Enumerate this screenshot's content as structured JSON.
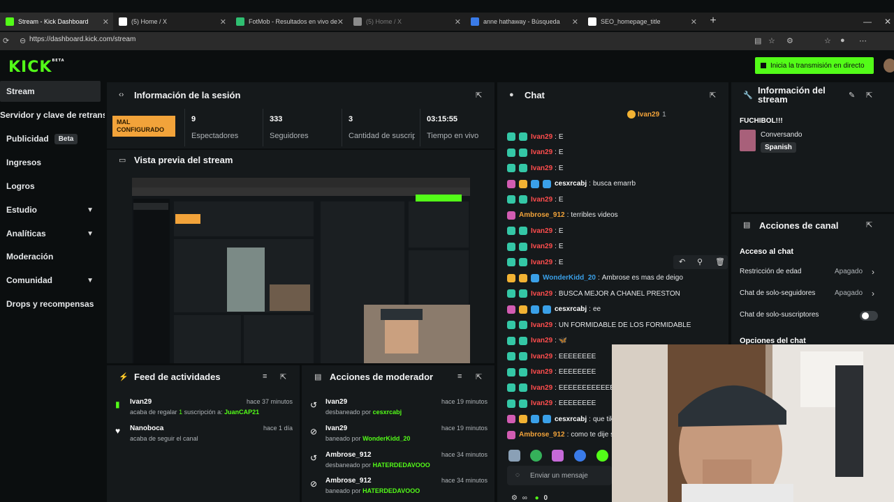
{
  "browser": {
    "tabs": [
      {
        "title": "Stream - Kick Dashboard",
        "favicon_color": "#53fc18"
      },
      {
        "title": "(5) Home / X",
        "favicon_color": "#ffffff"
      },
      {
        "title": "FotMob - Resultados en vivo de fú",
        "favicon_color": "#2fbf71"
      },
      {
        "title": "(5) Home / X",
        "favicon_color": "#8c8c8c"
      },
      {
        "title": "anne hathaway - Búsqueda",
        "favicon_color": "#3a7be8"
      },
      {
        "title": "SEO_homepage_title",
        "favicon_color": "#ffffff"
      }
    ],
    "url": "https://dashboard.kick.com/stream"
  },
  "header": {
    "logo": "KICK",
    "logo_badge": "BETA",
    "go_live": "Inicia la transmisión en directo",
    "accent": "#53fc18"
  },
  "sidebar": {
    "items": [
      {
        "label": "Stream",
        "active": true
      },
      {
        "label": "Servidor y clave de retransm"
      },
      {
        "label": "Publicidad",
        "badge": "Beta"
      },
      {
        "label": "Ingresos"
      },
      {
        "label": "Logros"
      },
      {
        "label": "Estudio",
        "chevron": true
      },
      {
        "label": "Analíticas",
        "chevron": true
      },
      {
        "label": "Moderación"
      },
      {
        "label": "Comunidad",
        "chevron": true
      },
      {
        "label": "Drops y recompensas"
      }
    ]
  },
  "session": {
    "title": "Información de la sesión",
    "status": "MAL CONFIGURADO",
    "stats": [
      {
        "value": "9",
        "label": "Espectadores"
      },
      {
        "value": "333",
        "label": "Seguidores"
      },
      {
        "value": "3",
        "label": "Cantidad de suscripciones"
      },
      {
        "value": "03:15:55",
        "label": "Tiempo en vivo"
      }
    ]
  },
  "preview": {
    "title": "Vista previa del stream"
  },
  "feed": {
    "title": "Feed de actividades",
    "items": [
      {
        "user": "Ivan29",
        "text_before": "acaba de regalar",
        "count": "1",
        "text_mid": "suscripción a:",
        "target": "JuanCAP21",
        "time": "hace 37 minutos"
      },
      {
        "user": "Nanoboca",
        "text": "acaba de seguir el canal",
        "time": "hace 1 día"
      }
    ]
  },
  "moderator": {
    "title": "Acciones de moderador",
    "items": [
      {
        "user": "Ivan29",
        "action": "desbaneado por",
        "by": "cesxrcabj",
        "time": "hace 19 minutos"
      },
      {
        "user": "Ivan29",
        "action": "baneado por",
        "by": "WonderKidd_20",
        "time": "hace 19 minutos"
      },
      {
        "user": "Ambrose_912",
        "action": "desbaneado por",
        "by": "HATERDEDAVOOO",
        "time": "hace 34 minutos"
      },
      {
        "user": "Ambrose_912",
        "action": "baneado por",
        "by": "HATERDEDAVOOO",
        "time": "hace 34 minutos"
      }
    ]
  },
  "chat": {
    "title": "Chat",
    "pinned_user": "Ivan29",
    "pinned_count": "1",
    "messages": [
      {
        "user": "Ivan29",
        "color": "red",
        "badges": [
          "g",
          "g"
        ],
        "text": "E"
      },
      {
        "user": "Ivan29",
        "color": "red",
        "badges": [
          "g",
          "g"
        ],
        "text": "E"
      },
      {
        "user": "Ivan29",
        "color": "red",
        "badges": [
          "g",
          "g"
        ],
        "text": "E"
      },
      {
        "user": "cesxrcabj",
        "color": "white",
        "badges": [
          "p",
          "y",
          "c",
          "c"
        ],
        "text": "busca emarrb"
      },
      {
        "user": "Ivan29",
        "color": "red",
        "badges": [
          "g",
          "g"
        ],
        "text": "E"
      },
      {
        "user": "Ambrose_912",
        "color": "orange",
        "badges": [
          "p"
        ],
        "text": "terribles videos"
      },
      {
        "user": "Ivan29",
        "color": "red",
        "badges": [
          "g",
          "g"
        ],
        "text": "E"
      },
      {
        "user": "Ivan29",
        "color": "red",
        "badges": [
          "g",
          "g"
        ],
        "text": "E"
      },
      {
        "user": "Ivan29",
        "color": "red",
        "badges": [
          "g",
          "g"
        ],
        "text": "E"
      },
      {
        "user": "WonderKidd_20",
        "color": "blue",
        "badges": [
          "y",
          "y",
          "c"
        ],
        "text": "Ambrose es mas de deigo"
      },
      {
        "user": "Ivan29",
        "color": "red",
        "badges": [
          "g",
          "g"
        ],
        "text": "BUSCA MEJOR A CHANEL PRESTON"
      },
      {
        "user": "cesxrcabj",
        "color": "white",
        "badges": [
          "p",
          "y",
          "c",
          "c"
        ],
        "text": "ee"
      },
      {
        "user": "Ivan29",
        "color": "red",
        "badges": [
          "g",
          "g"
        ],
        "text": "UN FORMIDABLE DE LOS FORMIDABLE"
      },
      {
        "user": "Ivan29",
        "color": "red",
        "badges": [
          "g",
          "g"
        ],
        "text": "🦋"
      },
      {
        "user": "Ivan29",
        "color": "red",
        "badges": [
          "g",
          "g"
        ],
        "text": "EEEEEEEE"
      },
      {
        "user": "Ivan29",
        "color": "red",
        "badges": [
          "g",
          "g"
        ],
        "text": "EEEEEEEE"
      },
      {
        "user": "Ivan29",
        "color": "red",
        "badges": [
          "g",
          "g"
        ],
        "text": "EEEEEEEEEEEE"
      },
      {
        "user": "Ivan29",
        "color": "red",
        "badges": [
          "g",
          "g"
        ],
        "text": "EEEEEEEE"
      },
      {
        "user": "cesxrcabj",
        "color": "white",
        "badges": [
          "p",
          "y",
          "c",
          "c"
        ],
        "text": "que tik"
      },
      {
        "user": "Ambrose_912",
        "color": "orange",
        "badges": [
          "p"
        ],
        "text": "como te dije s"
      }
    ],
    "input_placeholder": "Enviar un mensaje",
    "footer_count": "0"
  },
  "stream_info": {
    "title": "Información del stream",
    "stream_title": "FUCHIBOL!!!",
    "category": "Conversando",
    "language": "Spanish"
  },
  "channel_actions": {
    "title": "Acciones de canal",
    "section": "Acceso al chat",
    "rows": [
      {
        "label": "Restricción de edad",
        "value": "Apagado"
      },
      {
        "label": "Chat de solo-seguidores",
        "value": "Apagado"
      },
      {
        "label": "Chat de solo-suscriptores",
        "value": ""
      }
    ],
    "more": "Opciones del chat"
  }
}
